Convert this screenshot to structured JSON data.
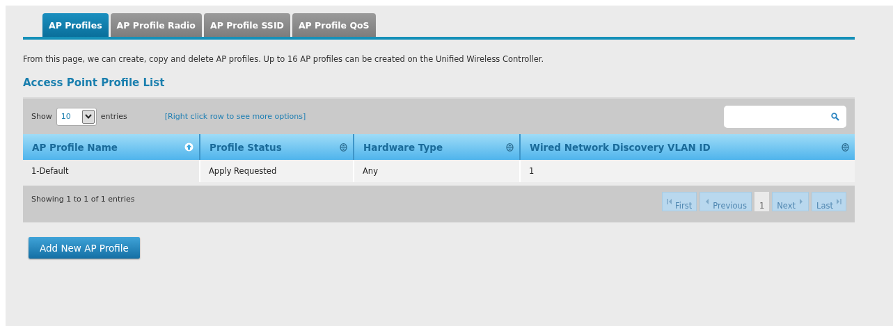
{
  "tabs": [
    {
      "label": "AP Profiles",
      "selected": true
    },
    {
      "label": "AP Profile Radio",
      "selected": false
    },
    {
      "label": "AP Profile SSID",
      "selected": false
    },
    {
      "label": "AP Profile QoS",
      "selected": false
    }
  ],
  "description": "From this page, we can create, copy and delete AP profiles. Up to 16 AP profiles can be created on the Unified Wireless Controller.",
  "section_title": "Access Point Profile List",
  "table": {
    "show_label": "Show",
    "page_size": "10",
    "entries_label": "entries",
    "hint": "[Right click row to see more options]",
    "columns": [
      {
        "label": "AP Profile Name",
        "sorted": true
      },
      {
        "label": "Profile Status",
        "sorted": false
      },
      {
        "label": "Hardware Type",
        "sorted": false
      },
      {
        "label": "Wired Network Discovery VLAN ID",
        "sorted": false
      }
    ],
    "rows": [
      [
        "1-Default",
        "Apply Requested",
        "Any",
        "1"
      ]
    ],
    "summary": "Showing 1 to 1 of 1 entries",
    "pagination": [
      {
        "kind": "first",
        "label": "First",
        "disabled": true
      },
      {
        "kind": "previous",
        "label": "Previous",
        "disabled": true
      },
      {
        "kind": "page",
        "label": "1"
      },
      {
        "kind": "next",
        "label": "Next",
        "disabled": true
      },
      {
        "kind": "last",
        "label": "Last",
        "disabled": true
      }
    ]
  },
  "add_button": "Add New AP Profile"
}
